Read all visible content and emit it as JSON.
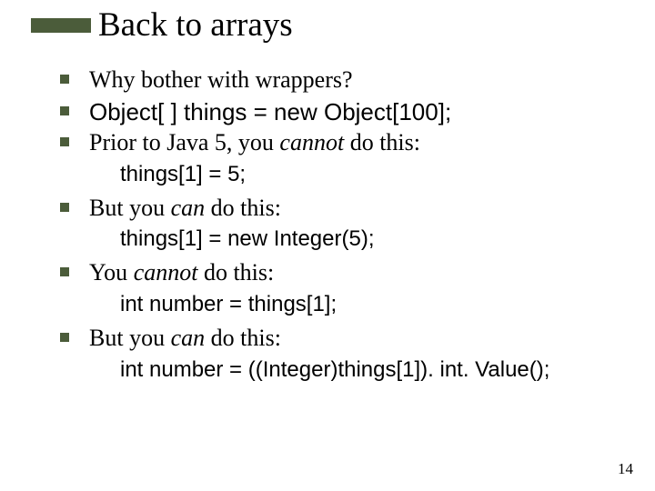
{
  "slide": {
    "title": "Back to arrays",
    "page_number": "14",
    "bullets": {
      "b0": "Why bother with wrappers?",
      "b1": "Object[ ] things = new Object[100];",
      "b2_a": "Prior to Java 5, you ",
      "b2_b": "cannot",
      "b2_c": " do this:",
      "sub2": "things[1] = 5;",
      "b3_a": "But you ",
      "b3_b": "can",
      "b3_c": " do this:",
      "sub3": "things[1] = new Integer(5);",
      "b4_a": "You ",
      "b4_b": "cannot",
      "b4_c": " do this:",
      "sub4": "int number = things[1];",
      "b5_a": "But you ",
      "b5_b": "can",
      "b5_c": " do this:",
      "sub5": "int number = ((Integer)things[1]). int. Value();"
    }
  }
}
